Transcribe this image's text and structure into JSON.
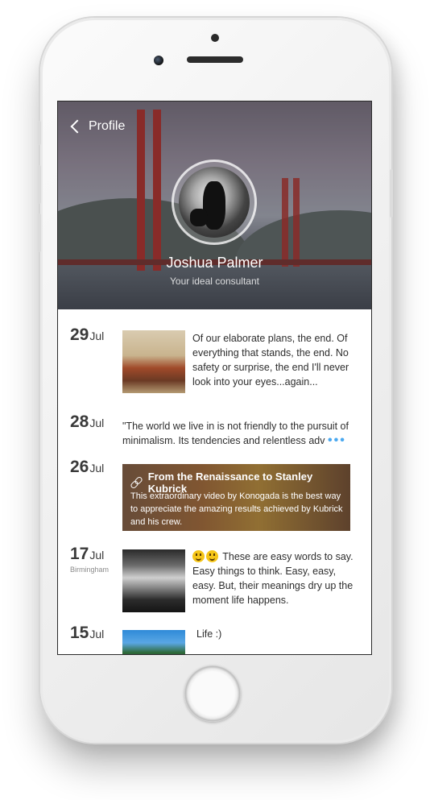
{
  "header": {
    "back_label": "Profile",
    "name": "Joshua Palmer",
    "tagline": "Your ideal consultant"
  },
  "entries": [
    {
      "day": "29",
      "month": "Jul",
      "place": "",
      "text": "Of our elaborate plans, the end. Of everything that stands, the end. No safety or surprise, the end I'll never look into your eyes...again..."
    },
    {
      "day": "28",
      "month": "Jul",
      "place": "",
      "text": "\"The world we live in is not friendly to the pursuit of minimalism. Its tendencies and relentless adv",
      "more": "•••"
    },
    {
      "day": "26",
      "month": "Jul",
      "place": "",
      "video_title": "From the Renaissance to Stanley Kubrick",
      "video_text": "This extraordinary video by Konogada is the best way to appreciate the amazing results achieved by Kubrick and his crew."
    },
    {
      "day": "17",
      "month": "Jul",
      "place": "Birmingham",
      "text": "These are easy words to say. Easy things to think. Easy, easy, easy. But, their meanings dry up the moment life happens."
    },
    {
      "day": "15",
      "month": "Jul",
      "place": "",
      "text": "Life :)"
    }
  ],
  "colors": {
    "accent": "#4aa8f0",
    "text": "#2e2e2e"
  }
}
